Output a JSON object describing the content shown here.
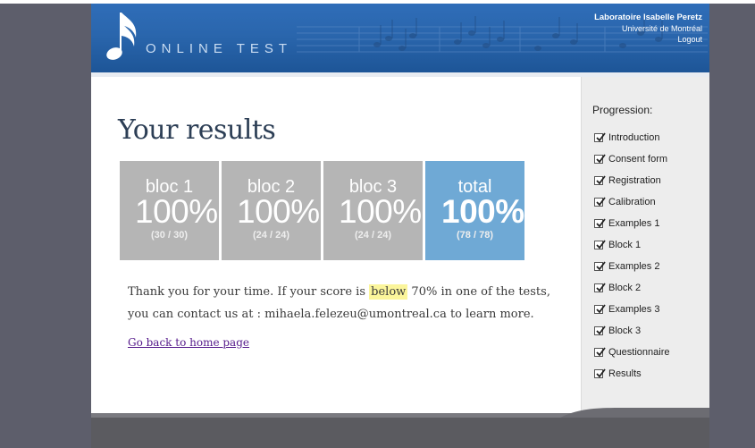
{
  "header": {
    "app_title": "ONLINE TEST",
    "lab_name": "Laboratoire Isabelle Peretz",
    "university": "Université de Montréal",
    "logout_label": "Logout",
    "logo_icon": "music-note-icon",
    "accent_color": "#2a66ad"
  },
  "main": {
    "title": "Your results",
    "scores": [
      {
        "label": "bloc 1",
        "percent": "100%",
        "count": "(30 / 30)"
      },
      {
        "label": "bloc 2",
        "percent": "100%",
        "count": "(24 / 24)"
      },
      {
        "label": "bloc 3",
        "percent": "100%",
        "count": "(24 / 24)"
      },
      {
        "label": "total",
        "percent": "100%",
        "count": "(78 / 78)"
      }
    ],
    "message_before": "Thank you for your time. If your score is ",
    "message_highlight": "below",
    "message_after": " 70% in one of the tests, you can contact us at : mihaela.felezeu@umontreal.ca to learn more.",
    "home_link": "Go back to home page"
  },
  "sidebar": {
    "title": "Progression:",
    "items": [
      {
        "label": "Introduction",
        "checked": true
      },
      {
        "label": "Consent form",
        "checked": true
      },
      {
        "label": "Registration",
        "checked": true
      },
      {
        "label": "Calibration",
        "checked": true
      },
      {
        "label": "Examples 1",
        "checked": true
      },
      {
        "label": "Block 1",
        "checked": true
      },
      {
        "label": "Examples 2",
        "checked": true
      },
      {
        "label": "Block 2",
        "checked": true
      },
      {
        "label": "Examples 3",
        "checked": true
      },
      {
        "label": "Block 3",
        "checked": true
      },
      {
        "label": "Questionnaire",
        "checked": true
      },
      {
        "label": "Results",
        "checked": true
      }
    ]
  }
}
